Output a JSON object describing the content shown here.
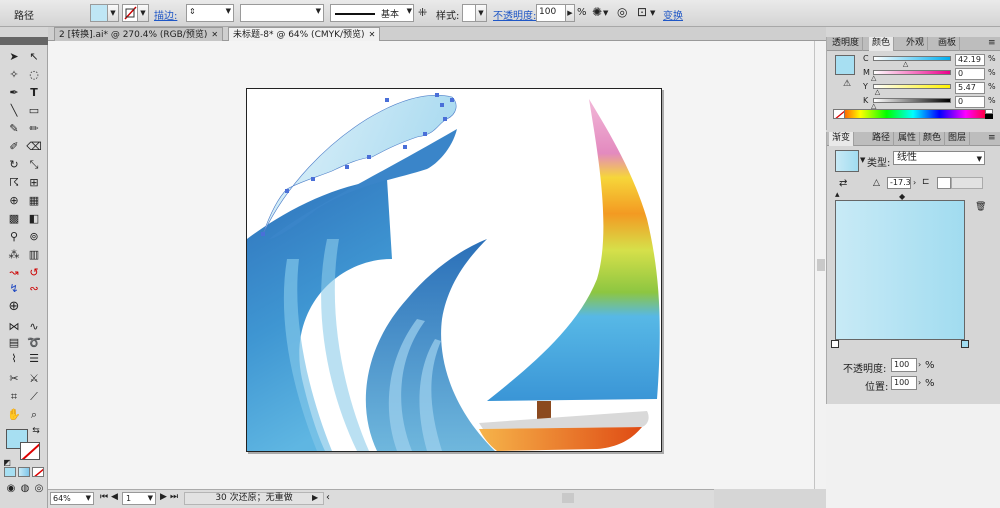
{
  "control_bar": {
    "object_type": "路径",
    "stroke_label": "描边:",
    "stroke_profile": "基本",
    "style_label": "样式:",
    "opacity_label": "不透明度:",
    "opacity_value": "100",
    "opacity_unit": "%",
    "transform_label": "变换"
  },
  "tabs": [
    {
      "label": "2 [转换].ai* @ 270.4% (RGB/预览)"
    },
    {
      "label": "未标题-8* @ 64% (CMYK/预览)"
    }
  ],
  "status": {
    "zoom": "64%",
    "artboard_index": "1",
    "message": "30 次还原；无重做"
  },
  "color_panel": {
    "tabs": [
      "透明度",
      "颜色",
      "外观",
      "画板"
    ],
    "active_tab": "颜色",
    "channels": [
      {
        "label": "C",
        "value": "42.19",
        "fraction": 0.42
      },
      {
        "label": "M",
        "value": "0",
        "fraction": 0.0
      },
      {
        "label": "Y",
        "value": "5.47",
        "fraction": 0.05
      },
      {
        "label": "K",
        "value": "0",
        "fraction": 0.0
      }
    ],
    "fill_color": "#a7dff2"
  },
  "gradient_panel": {
    "tabs": [
      "渐变",
      "路径",
      "属性",
      "颜色",
      "图层"
    ],
    "active_tab": "渐变",
    "type_label": "类型:",
    "type_value": "线性",
    "angle_value": "-17.3",
    "opacity_label": "不透明度:",
    "opacity_value": "100",
    "opacity_unit": "%",
    "location_label": "位置:",
    "location_value": "100",
    "location_unit": "%",
    "gradient_start": "#c8eaf6",
    "gradient_end": "#a1dcf0"
  }
}
